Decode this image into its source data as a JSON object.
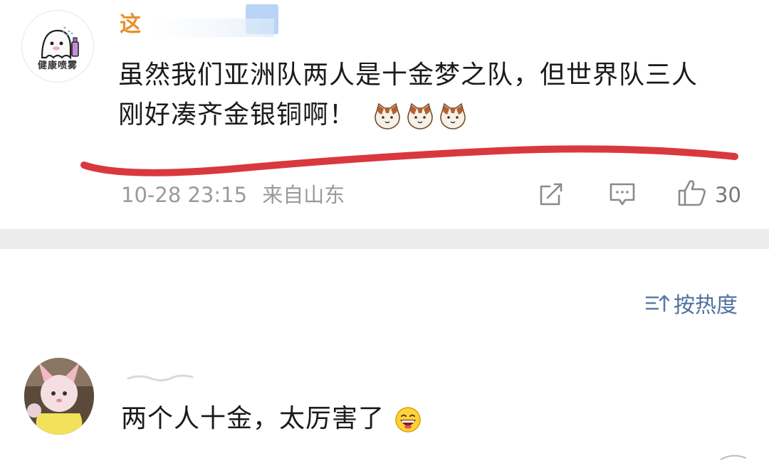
{
  "top_comment": {
    "avatar_caption": "健康喷雾",
    "username_visible": "这",
    "text_line1": "虽然我们亚洲队两人是十金梦之队，但世界队三人",
    "text_line2": "刚好凑齐金银铜啊！",
    "emoji_icons": [
      "cat-face-icon",
      "cat-face-icon",
      "cat-face-icon"
    ],
    "timestamp": "10-28 23:15",
    "location": "来自山东",
    "like_count": "30",
    "annotation_color": "#d9383f"
  },
  "sort": {
    "label": "按热度",
    "icon": "sort-icon"
  },
  "reply": {
    "text": "两个人十金，太厉害了",
    "emoji": "grinning-face-icon"
  },
  "colors": {
    "divider": "#ececec",
    "meta_text": "#9a9a9a",
    "link_blue": "#4f6f9c",
    "username_orange": "#e8912d"
  }
}
